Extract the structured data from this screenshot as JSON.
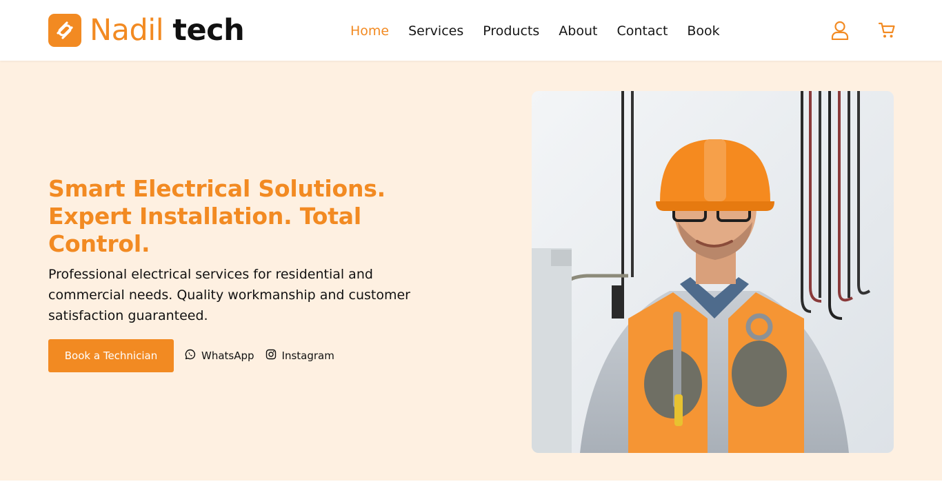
{
  "brand": {
    "name": "Nadil",
    "suffix": "tech",
    "logo_icon": "paperclip-logo-icon",
    "accent_color": "#f28a22",
    "hero_bg_color": "#fef0e1"
  },
  "nav": {
    "items": [
      {
        "label": "Home",
        "active": true
      },
      {
        "label": "Services",
        "active": false
      },
      {
        "label": "Products",
        "active": false
      },
      {
        "label": "About",
        "active": false
      },
      {
        "label": "Contact",
        "active": false
      },
      {
        "label": "Book",
        "active": false
      }
    ]
  },
  "header_icons": [
    "user-icon",
    "cart-icon"
  ],
  "hero": {
    "title": "Smart Electrical Solutions. Expert Installation. Total Control.",
    "description": "Professional electrical services for residential and commercial needs. Quality workmanship and customer satisfaction guaranteed.",
    "primary_button": "Book a Technician",
    "whatsapp_label": "WhatsApp",
    "whatsapp_icon": "whatsapp-icon",
    "instagram_label": "Instagram",
    "instagram_icon": "instagram-icon",
    "image_subject": "electrician-photo"
  }
}
